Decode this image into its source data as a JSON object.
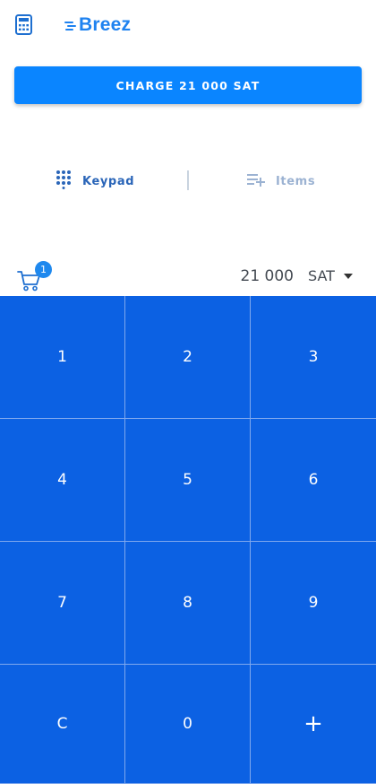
{
  "header": {
    "logo_text": "Breez",
    "calculator_icon": "calculator-icon",
    "brand_color": "#1e82f0"
  },
  "charge_button": {
    "label": "CHARGE 21 000 SAT",
    "color": "#0a85ff"
  },
  "tabs": [
    {
      "label": "Keypad",
      "icon": "keypad-grid-icon",
      "active": true
    },
    {
      "label": "Items",
      "icon": "playlist-add-icon",
      "active": false
    }
  ],
  "cart": {
    "icon": "cart-icon",
    "badge": "1"
  },
  "amount": {
    "value": "21 000",
    "currency": "SAT"
  },
  "keypad": {
    "color": "#0c61e3",
    "keys": [
      "1",
      "2",
      "3",
      "4",
      "5",
      "6",
      "7",
      "8",
      "9",
      "C",
      "0",
      "+"
    ]
  }
}
